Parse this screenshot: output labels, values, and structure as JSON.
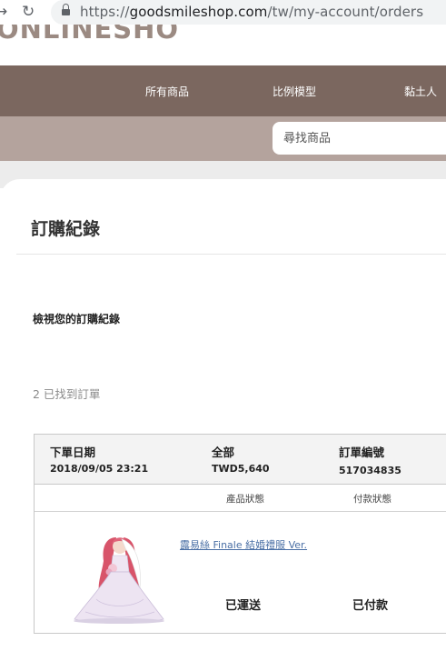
{
  "browser": {
    "url_host": "goodsmileshop.com",
    "url_prefix": "https://",
    "url_path": "/tw/my-account/orders"
  },
  "site": {
    "logo_text": "ONLINESHOP",
    "nav_items": [
      "所有商品",
      "比例模型",
      "黏土人"
    ],
    "search_placeholder": "尋找商品"
  },
  "page": {
    "title": "訂購紀錄",
    "section_heading": "檢視您的訂購紀錄",
    "orders_found": "2 已找到訂單"
  },
  "order": {
    "date_label": "下單日期",
    "date_value": "2018/09/05 23:21",
    "total_label": "全部",
    "total_value": "TWD5,640",
    "number_label": "訂單編號",
    "number_value": "517034835",
    "product_status_label": "產品狀態",
    "payment_status_label": "付款狀態",
    "product_name": "露易絲 Finale 結婚禮服 Ver.",
    "product_status": "已運送",
    "payment_status": "已付款"
  },
  "colors": {
    "nav_bg": "#7b675f",
    "subbar_bg": "#b4a39d",
    "link": "#4a6fa5"
  }
}
